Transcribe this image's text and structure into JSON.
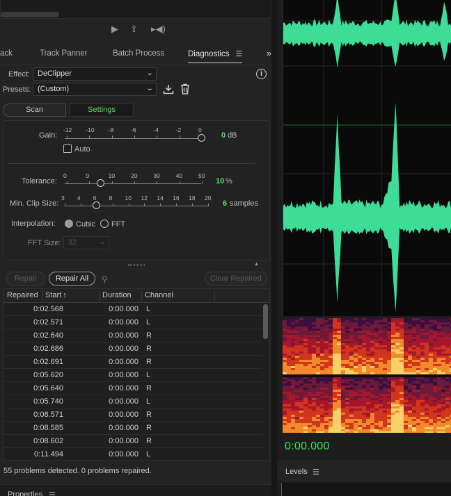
{
  "colors": {
    "accent_green": "#55e05e",
    "waveform": "#3ddc97",
    "panel": "#232323"
  },
  "tabs": [
    {
      "label": "ack",
      "active": false
    },
    {
      "label": "Track Panner",
      "active": false
    },
    {
      "label": "Batch Process",
      "active": false
    },
    {
      "label": "Diagnostics",
      "active": true
    }
  ],
  "effect": {
    "label": "Effect:",
    "value": "DeClipper"
  },
  "presets": {
    "label": "Presets:",
    "value": "(Custom)"
  },
  "mode": {
    "scan_label": "Scan",
    "settings_label": "Settings",
    "selected": "Settings"
  },
  "gain": {
    "label": "Gain:",
    "ticks": [
      "-12",
      "-10",
      "-8",
      "-6",
      "-4",
      "-2",
      "0"
    ],
    "value": "0",
    "unit": "dB",
    "auto_label": "Auto",
    "auto_checked": false,
    "level_fraction": 1.0
  },
  "tolerance": {
    "label": "Tolerance:",
    "ticks": [
      "0",
      "0",
      "10",
      "20",
      "30",
      "40",
      "50"
    ],
    "value": "10",
    "unit": "%",
    "level": 10
  },
  "min_clip": {
    "label": "Min. Clip Size:",
    "ticks": [
      "3",
      "4",
      "6",
      "8",
      "10",
      "12",
      "14",
      "16",
      "18",
      "20"
    ],
    "value": "6",
    "unit": "samples",
    "level": 6
  },
  "interpolation": {
    "label": "Interpolation:",
    "options": [
      "Cubic",
      "FFT"
    ],
    "selected": "Cubic"
  },
  "fft_size": {
    "label": "FFT Size:",
    "value": "32"
  },
  "actions": {
    "repair_label": "Repair",
    "repair_all_label": "Repair All",
    "clear_label": "Clear Repaired"
  },
  "table": {
    "columns": [
      "Repaired",
      "Start",
      "Duration",
      "Channel"
    ],
    "sort_column": "Start",
    "rows": [
      {
        "start": "0:02.568",
        "duration": "0:00.000",
        "channel": "L"
      },
      {
        "start": "0:02.571",
        "duration": "0:00.000",
        "channel": "L"
      },
      {
        "start": "0:02.640",
        "duration": "0:00.000",
        "channel": "R"
      },
      {
        "start": "0:02.686",
        "duration": "0:00.000",
        "channel": "R"
      },
      {
        "start": "0:02.691",
        "duration": "0:00.000",
        "channel": "R"
      },
      {
        "start": "0:05.620",
        "duration": "0:00.000",
        "channel": "L"
      },
      {
        "start": "0:05.640",
        "duration": "0:00.000",
        "channel": "R"
      },
      {
        "start": "0:05.740",
        "duration": "0:00.000",
        "channel": "L"
      },
      {
        "start": "0:08.571",
        "duration": "0:00.000",
        "channel": "R"
      },
      {
        "start": "0:08.585",
        "duration": "0:00.000",
        "channel": "R"
      },
      {
        "start": "0:08.602",
        "duration": "0:00.000",
        "channel": "R"
      },
      {
        "start": "0:11.494",
        "duration": "0:00.000",
        "channel": "L"
      }
    ]
  },
  "status": "55 problems detected. 0 problems repaired.",
  "properties_label": "Properties",
  "timecode": "0:00.000",
  "levels_label": "Levels"
}
